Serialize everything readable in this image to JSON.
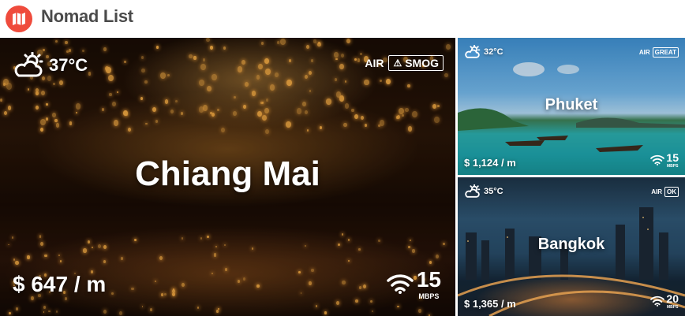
{
  "app": {
    "title": "Nomad List",
    "logo_icon": "map-icon",
    "brand_color": "#ef4b3c"
  },
  "cities": [
    {
      "name": "Chiang Mai",
      "temp": "37°C",
      "weather_icon": "cloud-sun-icon",
      "air_label": "AIR",
      "air_status": "SMOG",
      "air_icon": "warning-icon",
      "cost": "$ 647 / m",
      "wifi_speed": "15",
      "wifi_unit": "MBPS"
    },
    {
      "name": "Phuket",
      "temp": "32°C",
      "weather_icon": "cloud-sun-icon",
      "air_label": "AIR",
      "air_status": "GREAT",
      "cost": "$ 1,124 / m",
      "wifi_speed": "15",
      "wifi_unit": "MBPS"
    },
    {
      "name": "Bangkok",
      "temp": "35°C",
      "weather_icon": "cloud-sun-icon",
      "air_label": "AIR",
      "air_status": "OK",
      "cost": "$ 1,365 / m",
      "wifi_speed": "20",
      "wifi_unit": "MBPS"
    }
  ]
}
